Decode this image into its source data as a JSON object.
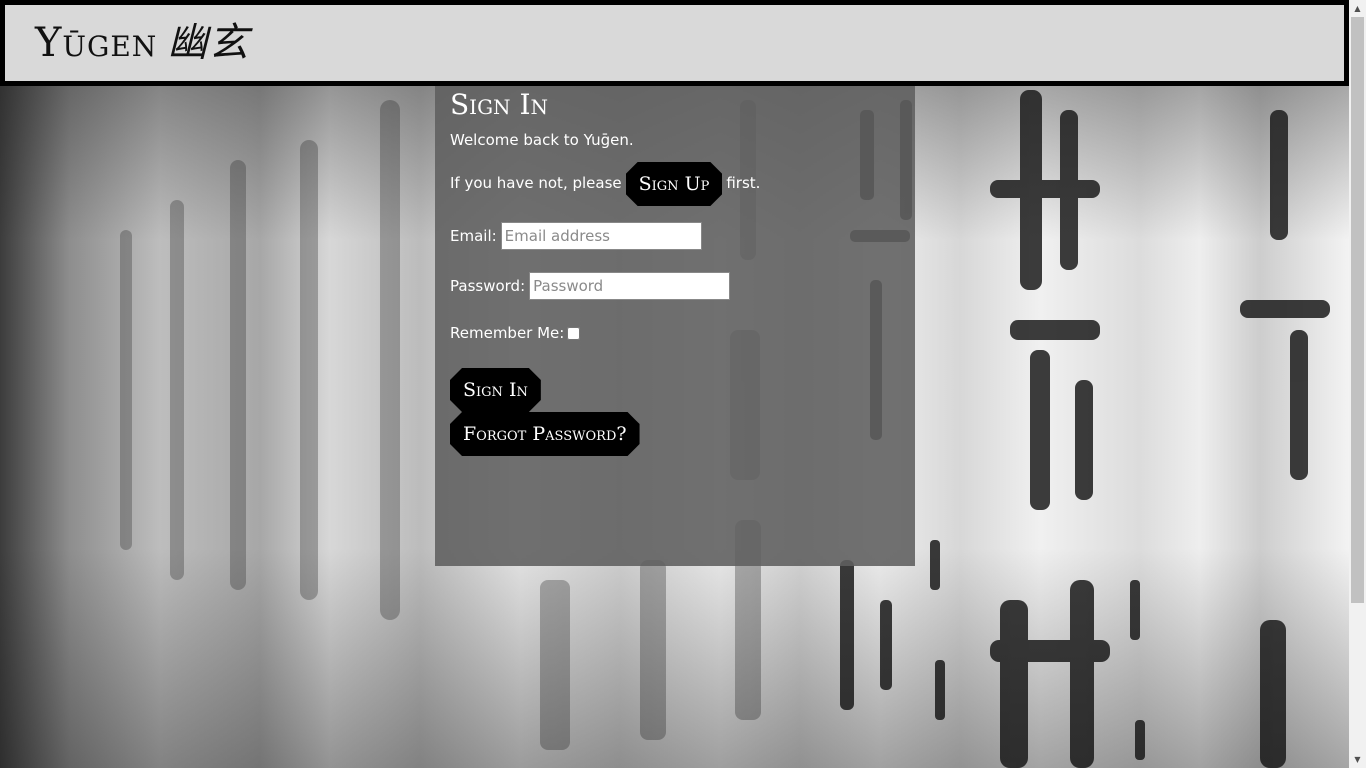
{
  "header": {
    "brand": "Yūgen",
    "brand_kanji": "幽玄"
  },
  "signin": {
    "title": "Sign In",
    "welcome": "Welcome back to Yuḡen.",
    "prompt_before": "If you have not, please",
    "signup_label": "Sign Up",
    "prompt_after": "first.",
    "email_label": "Email:",
    "email_placeholder": "Email address",
    "email_value": "",
    "password_label": "Password:",
    "password_placeholder": "Password",
    "password_value": "",
    "remember_label": "Remember Me:",
    "remember_checked": false,
    "submit_label": "Sign In",
    "forgot_label": "Forgot Password?"
  },
  "colors": {
    "header_bg": "#d9d9d9",
    "header_border": "#000000",
    "panel_bg": "#5f5f5f",
    "button_bg": "#000000",
    "text_light": "#ffffff"
  }
}
